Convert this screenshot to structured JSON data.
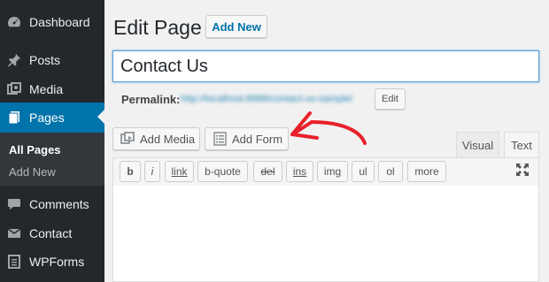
{
  "sidebar": {
    "items": [
      {
        "label": "Dashboard",
        "icon": "dashboard-icon"
      },
      {
        "label": "Posts",
        "icon": "pin-icon"
      },
      {
        "label": "Media",
        "icon": "media-icon"
      },
      {
        "label": "Pages",
        "icon": "pages-icon"
      },
      {
        "label": "Comments",
        "icon": "comment-icon"
      },
      {
        "label": "Contact",
        "icon": "mail-icon"
      },
      {
        "label": "WPForms",
        "icon": "wpforms-icon"
      }
    ],
    "submenu": [
      "All Pages",
      "Add New"
    ],
    "active_color": "#0073aa"
  },
  "header": {
    "title": "Edit Page",
    "add_new_label": "Add New"
  },
  "post": {
    "title": "Contact Us"
  },
  "permalink": {
    "label": "Permalink:",
    "url": "http://localhost:8888/contact-us-sample/",
    "edit_label": "Edit"
  },
  "media_buttons": {
    "add_media": "Add Media",
    "add_form": "Add Form"
  },
  "editor_tabs": {
    "visual": "Visual",
    "text": "Text"
  },
  "quicktags": [
    "b",
    "i",
    "link",
    "b-quote",
    "del",
    "ins",
    "img",
    "ul",
    "ol",
    "more"
  ],
  "annotation": {
    "arrow_color": "#e8202a"
  }
}
